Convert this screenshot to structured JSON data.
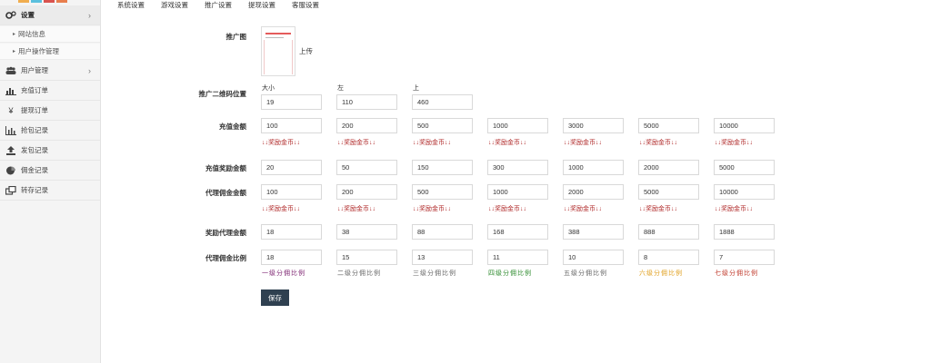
{
  "swatch_colors": [
    "#f0ad4e",
    "#5bc0de",
    "#d9534f",
    "#e87e4d"
  ],
  "sidebar": {
    "items": [
      {
        "name": "settings",
        "icon": "gears-icon",
        "label": "设置",
        "chevron": "›",
        "active": true
      },
      {
        "name": "website-info",
        "label": "网站信息",
        "sub": true
      },
      {
        "name": "user-operation-management",
        "label": "用户操作管理",
        "sub": true
      },
      {
        "name": "user-management",
        "icon": "users-icon",
        "label": "用户管理",
        "chevron": "›"
      },
      {
        "name": "recharge-orders",
        "icon": "bar-chart-icon",
        "label": "充值订单"
      },
      {
        "name": "withdraw-orders",
        "icon": "yen-icon",
        "label": "提现订单"
      },
      {
        "name": "grab-packet-records",
        "icon": "column-chart-icon",
        "label": "抢包记录"
      },
      {
        "name": "send-packet-records",
        "icon": "upload-icon",
        "label": "发包记录"
      },
      {
        "name": "commission-records",
        "icon": "pie-chart-icon",
        "label": "佣金记录"
      },
      {
        "name": "transfer-records",
        "icon": "windows-icon",
        "label": "转存记录"
      }
    ]
  },
  "tabs": [
    "系统设置",
    "游戏设置",
    "推广设置",
    "提现设置",
    "客服设置"
  ],
  "form": {
    "promo_image": {
      "label": "推广图",
      "upload_label": "上传"
    },
    "qr_position": {
      "label": "推广二维码位置",
      "fields": [
        {
          "caption": "大小",
          "value": "19"
        },
        {
          "caption": "左",
          "value": "110"
        },
        {
          "caption": "上",
          "value": "460"
        }
      ]
    },
    "recharge_amount": {
      "label": "充值金额",
      "values": [
        "100",
        "200",
        "500",
        "1000",
        "3000",
        "5000",
        "10000"
      ],
      "hint": "↓↓奖励金币↓↓"
    },
    "recharge_reward": {
      "label": "充值奖励金额",
      "values": [
        "20",
        "50",
        "150",
        "300",
        "1000",
        "2000",
        "5000"
      ]
    },
    "agent_commission": {
      "label": "代理佣金金额",
      "values": [
        "100",
        "200",
        "500",
        "1000",
        "2000",
        "5000",
        "10000"
      ],
      "hint": "↓↓奖励金币↓↓"
    },
    "agent_reward": {
      "label": "奖励代理金额",
      "values": [
        "18",
        "38",
        "88",
        "168",
        "388",
        "888",
        "1888"
      ]
    },
    "commission_ratio": {
      "label": "代理佣金比例",
      "values": [
        "18",
        "15",
        "13",
        "11",
        "10",
        "8",
        "7"
      ],
      "captions": [
        "一级分佣比例",
        "二级分佣比例",
        "三级分佣比例",
        "四级分佣比例",
        "五级分佣比例",
        "六级分佣比例",
        "七级分佣比例"
      ],
      "caption_colors": [
        "#7a1f6e",
        "#666666",
        "#666666",
        "#2e8b2e",
        "#666666",
        "#e0a020",
        "#c0392b"
      ]
    }
  },
  "save_label": "保存"
}
